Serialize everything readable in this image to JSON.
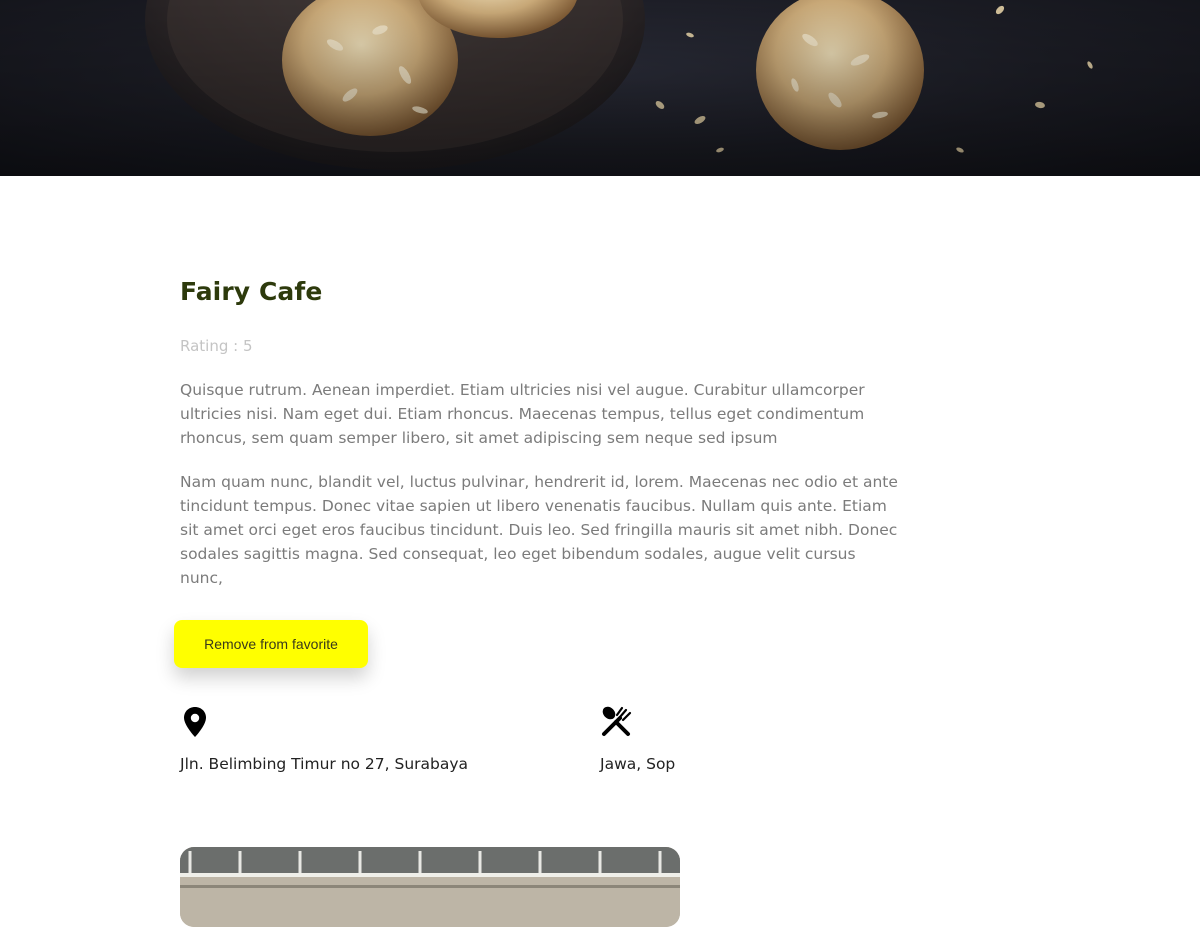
{
  "hero": {
    "image_subject": "almond cookies on a dark wooden plate"
  },
  "restaurant": {
    "name": "Fairy Cafe",
    "rating_label": "Rating : 5",
    "description": [
      "Quisque rutrum. Aenean imperdiet. Etiam ultricies nisi vel augue. Curabitur ullamcorper ultricies nisi. Nam eget dui. Etiam rhoncus. Maecenas tempus, tellus eget condimentum rhoncus, sem quam semper libero, sit amet adipiscing sem neque sed ipsum",
      "Nam quam nunc, blandit vel, luctus pulvinar, hendrerit id, lorem. Maecenas nec odio et ante tincidunt tempus. Donec vitae sapien ut libero venenatis faucibus. Nullam quis ante. Etiam sit amet orci eget eros faucibus tincidunt. Duis leo. Sed fringilla mauris sit amet nibh. Donec sodales sagittis magna. Sed consequat, leo eget bibendum sodales, augue velit cursus nunc,"
    ],
    "favorite_button_label": "Remove from favorite",
    "address": "Jln. Belimbing Timur no 27, Surabaya",
    "address_icon": "map-pin-icon",
    "categories": "Jawa, Sop",
    "categories_icon": "utensils-icon"
  },
  "photo": {
    "image_subject": "restaurant building facade"
  },
  "colors": {
    "title": "#2d3a0c",
    "accent_button": "#ffff00",
    "muted_text": "#c4c4c4",
    "body_text": "#7b7b7b"
  }
}
